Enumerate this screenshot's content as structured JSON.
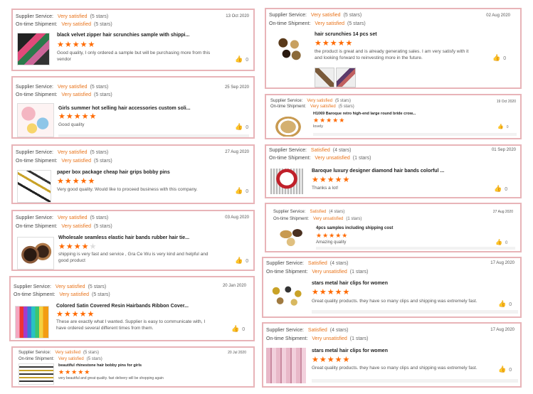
{
  "labels": {
    "supplier": "Supplier Service:",
    "shipment": "On-time Shipment:"
  },
  "reviews": [
    {
      "supplier_rating": "Very satisfied",
      "supplier_count": "(5 stars)",
      "shipment_rating": "Very satisfied",
      "shipment_count": "(5 stars)",
      "date": "13 Oct 2020",
      "product": "black velvet zipper hair scrunchies sample with shippi...",
      "stars": 5,
      "comment": "Good quality, I only ordered a sample but will be purchasing more from this vendor",
      "likes": "0"
    },
    {
      "supplier_rating": "Very satisfied",
      "supplier_count": "(5 stars)",
      "shipment_rating": "Very satisfied",
      "shipment_count": "(5 stars)",
      "date": "25 Sep 2020",
      "product": "Girls summer hot selling hair accessories custom soli...",
      "stars": 5,
      "comment": "Good quality",
      "likes": "0"
    },
    {
      "supplier_rating": "Very satisfied",
      "supplier_count": "(5 stars)",
      "shipment_rating": "Very satisfied",
      "shipment_count": "(5 stars)",
      "date": "27 Aug 2020",
      "product": "paper box package cheap hair grips bobby pins",
      "stars": 5,
      "comment": "Very good quality. Would like to proceed business with this company.",
      "likes": "0"
    },
    {
      "supplier_rating": "Very satisfied",
      "supplier_count": "(5 stars)",
      "shipment_rating": "Very satisfied",
      "shipment_count": "(5 stars)",
      "date": "03 Aug 2020",
      "product": "Wholesale seamless elastic hair bands rubber hair tie...",
      "stars": 4,
      "comment": "shipping is very fast and service , Gra  Ce Wu is very kind and helpful and good product",
      "likes": "0"
    },
    {
      "supplier_rating": "Very satisfied",
      "supplier_count": "(5 stars)",
      "shipment_rating": "Very satisfied",
      "shipment_count": "(5 stars)",
      "date": "20 Jan 2020",
      "product": "Colored Satin Covered Resin Hairbands Ribbon Cover...",
      "stars": 5,
      "comment": "These are exactly what I wanted. Supplier is easy to communicate with, I have ordered several different times from them.",
      "likes": "0"
    },
    {
      "supplier_rating": "Very satisfied",
      "supplier_count": "(5 stars)",
      "shipment_rating": "Very satisfied",
      "shipment_count": "(5 stars)",
      "date": "20 Jul 2020",
      "product": "beautiful rhinestone hair bobby pins for girls",
      "stars": 5,
      "comment": "very beautiful and great quality. fast delivery will be shopping again",
      "likes": ""
    },
    {
      "supplier_rating": "Very satisfied",
      "supplier_count": "(5 stars)",
      "shipment_rating": "Very satisfied",
      "shipment_count": "(5 stars)",
      "date": "02 Aug 2020",
      "product": "hair scrunchies 14 pcs set",
      "stars": 5,
      "comment": "the product is great and is already generating sales. I am very satisfy with it and looking forward to reinvesting more in the future.",
      "likes": "0"
    },
    {
      "supplier_rating": "Very satisfied",
      "supplier_count": "(5 stars)",
      "shipment_rating": "Very satisfied",
      "shipment_count": "(5 stars)",
      "date": "19 Oct 2020",
      "product": "H1069 Baroque retro high-end large round bride crow...",
      "stars": 5,
      "comment": "lovely",
      "likes": "0"
    },
    {
      "supplier_rating": "Satisfied",
      "supplier_count": "(4 stars)",
      "shipment_rating": "Very unsatisfied",
      "shipment_count": "(1 stars)",
      "date": "01 Sep 2020",
      "product": "Baroque luxury designer diamond hair bands colorful ...",
      "stars": 5,
      "comment": "Thanks a lot!",
      "likes": "0"
    },
    {
      "supplier_rating": "Satisfied",
      "supplier_count": "(4 stars)",
      "shipment_rating": "Very unsatisfied",
      "shipment_count": "(1 stars)",
      "date": "27 Aug 2020",
      "product": "4pcs samples including shipping cost",
      "stars": 5,
      "comment": "Amazing quality",
      "likes": "0"
    },
    {
      "supplier_rating": "Satisfied",
      "supplier_count": "(4 stars)",
      "shipment_rating": "Very unsatisfied",
      "shipment_count": "(1 stars)",
      "date": "17 Aug 2020",
      "product": "stars metal hair clips for women",
      "stars": 5,
      "comment": "Great quality products. they have so many clips and shipping was extremely fast.",
      "likes": "0"
    },
    {
      "supplier_rating": "Satisfied",
      "supplier_count": "(4 stars)",
      "shipment_rating": "Very unsatisfied",
      "shipment_count": "(1 stars)",
      "date": "17 Aug 2020",
      "product": "stars metal hair clips for women",
      "stars": 5,
      "comment": "Great quality products. they have so many clips and shipping was extremely fast.",
      "likes": "0"
    }
  ]
}
